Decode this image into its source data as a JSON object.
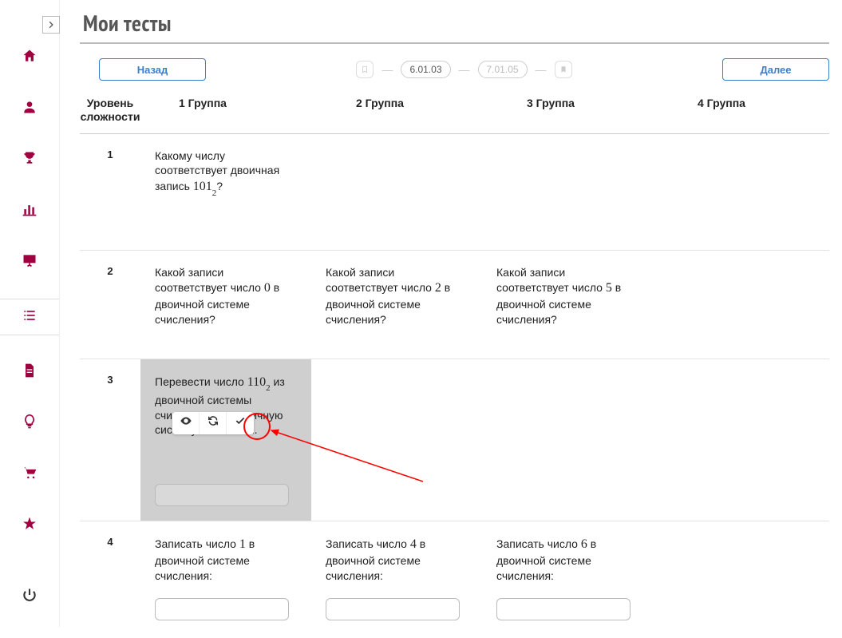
{
  "page": {
    "title": "Мои тесты"
  },
  "nav": {
    "back": "Назад",
    "forward": "Далее",
    "code_current": "6.01.03",
    "code_next": "7.01.05"
  },
  "table": {
    "head": {
      "level_line1": "Уровень",
      "level_line2": "сложности",
      "g1": "1 Группа",
      "g2": "2 Группа",
      "g3": "3 Группа",
      "g4": "4 Группа"
    },
    "rows": [
      {
        "level": "1",
        "g1_pre": "Какому числу соответствует двоичная запись ",
        "g1_num": "101",
        "g1_sub": "2",
        "g1_post": "?"
      },
      {
        "level": "2",
        "g1_pre": " Какой записи соответствует число ",
        "g1_num": "0",
        "g1_post": " в двоичной системе счисления?",
        "g2_pre": " Какой записи соответствует число ",
        "g2_num": "2",
        "g2_post": " в двоичной системе счисления?",
        "g3_pre": " Какой записи соответствует число ",
        "g3_num": "5",
        "g3_post": " в двоичной системе счисления?"
      },
      {
        "level": "3",
        "g1_pre": "Перевести число ",
        "g1_num": "110",
        "g1_sub": "2",
        "g1_post": " из двоичной системы счисления в десятичную систему счисления."
      },
      {
        "level": "4",
        "g1_pre": "Записать число ",
        "g1_num": "1",
        "g1_post": " в двоичной системе счисления:",
        "g2_pre": "Записать число ",
        "g2_num": "4",
        "g2_post": " в двоичной системе счисления:",
        "g3_pre": "Записать число ",
        "g3_num": "6",
        "g3_post": " в двоичной системе счисления:"
      }
    ]
  },
  "card_toolbar": {
    "view": "eye-icon",
    "refresh": "refresh-icon",
    "confirm": "check-icon"
  },
  "sidebar": {
    "toggle": ">",
    "items": [
      "home",
      "user",
      "trophy",
      "stats",
      "board",
      "list",
      "doc",
      "bulb",
      "cart",
      "star"
    ],
    "power": "power"
  }
}
